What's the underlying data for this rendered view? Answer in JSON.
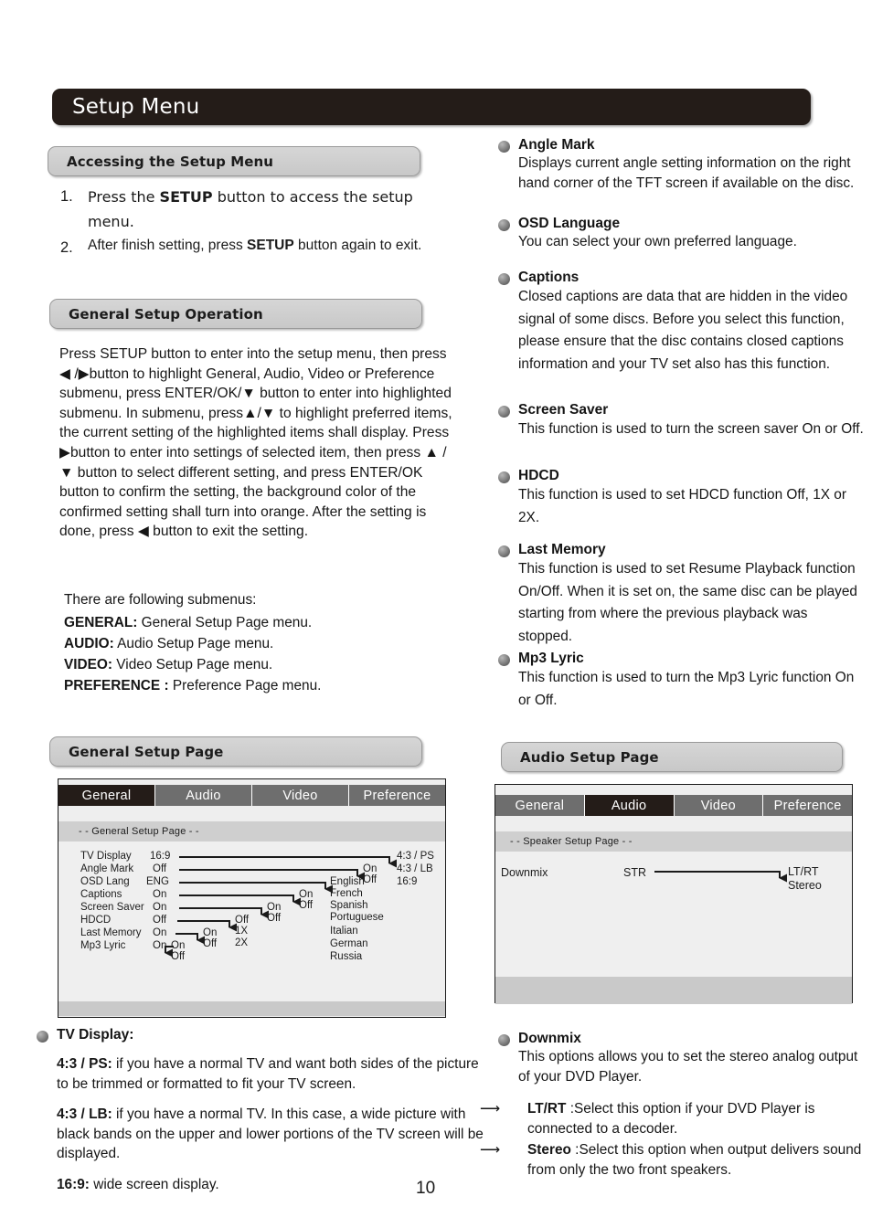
{
  "document": {
    "title": "Setup Menu",
    "page_number": "10"
  },
  "sections": {
    "accessing": {
      "header": "Accessing the Setup Menu",
      "steps": [
        {
          "num": "1.",
          "pre": "Press the ",
          "bold": "SETUP",
          "post": " button to access the setup menu."
        },
        {
          "num": "2.",
          "pre": "After finish setting, press ",
          "bold": "SETUP",
          "post": " button again to exit."
        }
      ]
    },
    "general_operation": {
      "header": "General Setup Operation",
      "paragraph": "Press SETUP button to enter into the setup menu, then press ◀ /▶button to highlight General, Audio, Video or Preference submenu, press ENTER/OK/▼ button to enter into highlighted submenu. In submenu, press▲/▼ to highlight preferred items, the current setting of the highlighted items shall display. Press ▶button to enter into settings of selected item, then press ▲ /▼ button to select different setting, and press ENTER/OK button to confirm the setting, the background color of the confirmed setting shall turn into orange. After the setting is done, press ◀ button to exit the setting.",
      "submenu_lead": "There are following submenus:",
      "submenus": [
        {
          "key": "GENERAL:",
          "desc": " General Setup Page menu."
        },
        {
          "key": "AUDIO:",
          "desc": " Audio Setup Page menu."
        },
        {
          "key": "VIDEO:",
          "desc": " Video Setup Page menu."
        },
        {
          "key": "PREFERENCE :",
          "desc": " Preference Page menu."
        }
      ]
    },
    "general_setup_page": {
      "header": "General Setup Page"
    },
    "audio_setup_page": {
      "header": "Audio Setup Page"
    }
  },
  "general_screen": {
    "tabs": [
      {
        "label": "General",
        "active": true
      },
      {
        "label": "Audio",
        "active": false
      },
      {
        "label": "Video",
        "active": false
      },
      {
        "label": "Preference",
        "active": false
      }
    ],
    "subtitle": "- -  General Setup Page  - -",
    "rows": [
      {
        "label": "TV Display",
        "value": "16:9",
        "options": [
          "4:3 / PS",
          "4:3 / LB",
          "16:9"
        ]
      },
      {
        "label": "Angle Mark",
        "value": "Off",
        "options": [
          "On",
          "Off"
        ]
      },
      {
        "label": "OSD Lang",
        "value": "ENG",
        "options": [
          "English",
          "French",
          "Spanish",
          "Portuguese",
          "Italian",
          "German",
          "Russia"
        ]
      },
      {
        "label": "Captions",
        "value": "On",
        "options": [
          "On",
          "Off"
        ]
      },
      {
        "label": "Screen Saver",
        "value": "On",
        "options": [
          "On",
          "Off"
        ]
      },
      {
        "label": "HDCD",
        "value": "Off",
        "options": [
          "Off",
          "1X",
          "2X"
        ]
      },
      {
        "label": "Last Memory",
        "value": "On",
        "options": [
          "On",
          "Off"
        ]
      },
      {
        "label": "Mp3 Lyric",
        "value": "On",
        "options": [
          "On",
          "Off"
        ]
      }
    ]
  },
  "audio_screen": {
    "tabs": [
      {
        "label": "General",
        "active": false
      },
      {
        "label": "Audio",
        "active": true
      },
      {
        "label": "Video",
        "active": false
      },
      {
        "label": "Preference",
        "active": false
      }
    ],
    "subtitle": "- -  Speaker Setup  Page  - -",
    "rows": [
      {
        "label": "Downmix",
        "value": "STR",
        "options": [
          "LT/RT",
          "Stereo"
        ]
      }
    ]
  },
  "right_column_bullets": [
    {
      "title": "Angle Mark",
      "body": "Displays current angle setting information on the right  hand  corner of  the TFT  screen if available on the disc."
    },
    {
      "title": " OSD Language",
      "body": " You can select your own preferred language."
    },
    {
      "title": "Captions",
      "body": "Closed captions are data that are hidden in the video signal of some discs. Before you select this function, please ensure that the disc contains closed captions information and  your TV set also has this function."
    },
    {
      "title": "Screen Saver",
      "body": "This function is used to turn the screen saver On or Off."
    },
    {
      "title": "HDCD",
      "body": "This function is used to set HDCD function Off, 1X or 2X."
    },
    {
      "title": "Last Memory",
      "body": "This function is used to set Resume Playback function On/Off. When it is set on, the same disc can be played starting from where the previous playback was stopped."
    },
    {
      "title": "Mp3 Lyric",
      "body": "This function is used to turn the Mp3 Lyric function On or Off."
    }
  ],
  "tv_display_note": {
    "title": "TV Display:",
    "items": [
      {
        "key": "4:3 / PS:",
        "desc": " if you have a normal TV and want both sides of the picture to be trimmed or formatted to fit your TV screen."
      },
      {
        "key": "4:3 / LB:",
        "desc": " if you have a normal TV. In this case, a wide picture with black bands on the upper and lower portions of the TV screen will be displayed."
      },
      {
        "key": "16:9:",
        "desc": " wide screen display."
      }
    ]
  },
  "downmix_note": {
    "title": "Downmix",
    "body": "This options allows you to set the stereo analog output of your DVD Player.",
    "options": [
      {
        "key": "LT/RT",
        "desc": " :Select  this option if your DVD Player is connected to a decoder."
      },
      {
        "key": "Stereo",
        "desc": " :Select this option when output delivers sound from only the two  front speakers."
      }
    ]
  },
  "colors": {
    "title_bar": "#241c18",
    "pill": "#d0d0d0",
    "tab_active": "#241c18",
    "tab_inactive": "#6e6e6e",
    "screen_bg": "#eeeeee"
  }
}
